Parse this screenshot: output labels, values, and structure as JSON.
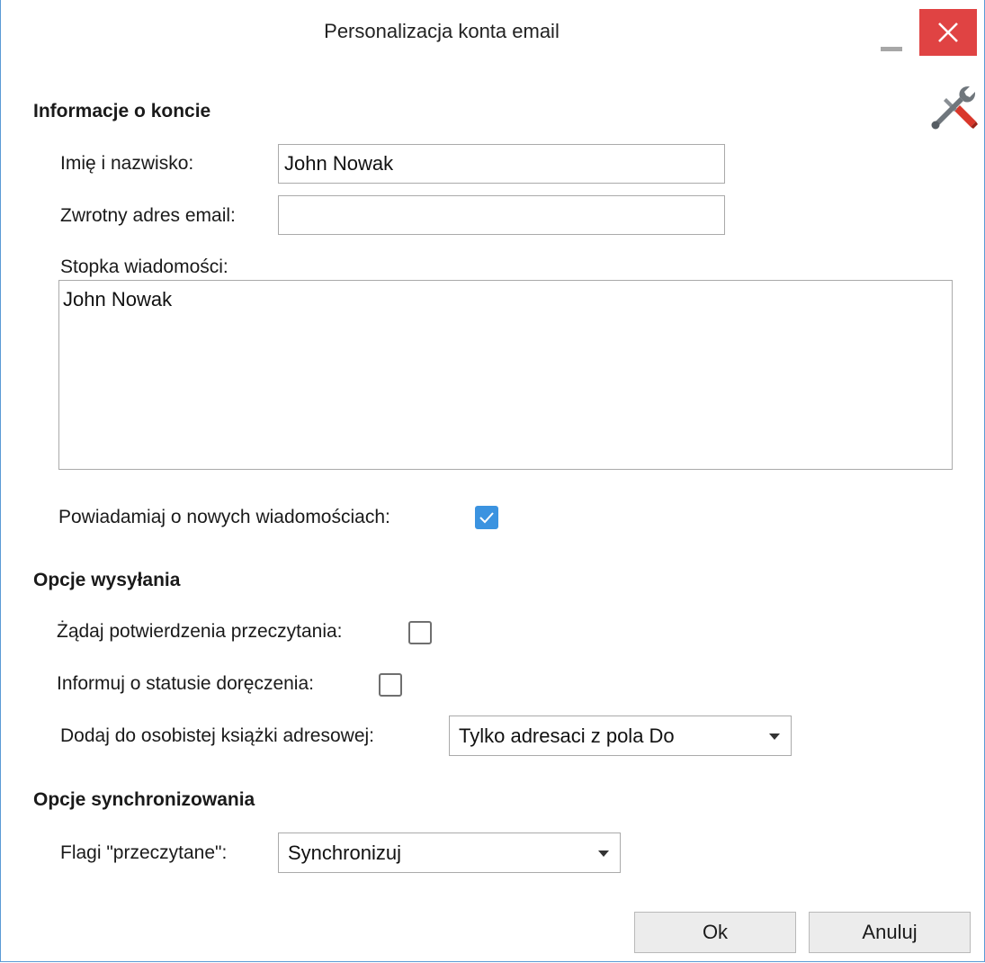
{
  "window": {
    "title": "Personalizacja konta email"
  },
  "account_info": {
    "section_title": "Informacje o koncie",
    "name_label": "Imię i nazwisko:",
    "name_value": "John Nowak",
    "reply_label": "Zwrotny adres email:",
    "reply_value": "",
    "footer_label": "Stopka wiadomości:",
    "footer_value": "John Nowak",
    "notify_label": "Powiadamiaj o nowych wiadomościach:",
    "notify_checked": true
  },
  "send_options": {
    "section_title": "Opcje wysyłania",
    "read_receipt_label": "Żądaj potwierdzenia przeczytania:",
    "read_receipt_checked": false,
    "delivery_status_label": "Informuj o statusie doręczenia:",
    "delivery_status_checked": false,
    "address_book_label": "Dodaj do osobistej książki adresowej:",
    "address_book_value": "Tylko adresaci z pola Do"
  },
  "sync_options": {
    "section_title": "Opcje synchronizowania",
    "read_flags_label": "Flagi \"przeczytane\":",
    "read_flags_value": "Synchronizuj"
  },
  "buttons": {
    "ok_label": "Ok",
    "cancel_label": "Anuluj"
  },
  "icons": {
    "close": "close-icon",
    "minimize": "minimize-icon",
    "tools": "tools-icon",
    "checkmark": "checkmark-icon",
    "dropdown": "chevron-down-icon"
  },
  "colors": {
    "close_button": "#e04343",
    "checkbox_checked": "#3b93e0",
    "window_border": "#5b9bd5",
    "button_background": "#ececec"
  }
}
